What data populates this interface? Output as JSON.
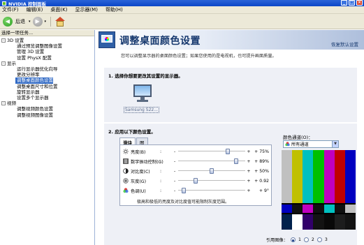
{
  "window": {
    "title": "NVIDIA 控制面板"
  },
  "menu": [
    "文件(F)",
    "编辑(E)",
    "桌面(K)",
    "显示器(M)",
    "帮助(H)"
  ],
  "toolbar": {
    "back_label": "后退"
  },
  "left": {
    "header": "选择一项任务...",
    "tree": [
      {
        "category": "3D 设置",
        "expanded": "-",
        "items": [
          "通过预览调整图像设置",
          "管理 3D 设置",
          "设置 PhysX 配置"
        ]
      },
      {
        "category": "显示",
        "expanded": "-",
        "items": [
          "运行显示器优化向导",
          "更改分辨率",
          "调整桌面颜色设置",
          "调整桌面尺寸和位置",
          "旋转显示器",
          "设置多个显示器"
        ]
      },
      {
        "category": "视频",
        "expanded": "-",
        "items": [
          "调整视频颜色设置",
          "调整视频图像设置"
        ]
      }
    ],
    "selected": "调整桌面颜色设置"
  },
  "main": {
    "title": "调整桌面颜色设置",
    "restore": "恢复默认设置",
    "description": "您可以调整显示器的桌面颜色设置；如果您使用的是电视机，也可提升画面质量。",
    "step1": "1. 选择你想要更改其设置的显示器。",
    "monitor_label": "Samsung S22...",
    "step2": "2. 应用以下颜色设置。",
    "tabs": [
      "滑块",
      "图"
    ],
    "sliders": [
      {
        "name": "亮度(B)",
        "value": "+ 75%",
        "level": 0.75,
        "icon": "brightness-icon"
      },
      {
        "name": "数字振动控制(G)",
        "value": "+ 89%",
        "level": 0.89,
        "icon": "vibrance-icon"
      },
      {
        "name": "对比度(C)",
        "value": "+ 50%",
        "level": 0.5,
        "icon": "contrast-icon"
      },
      {
        "name": "灰度(G)",
        "value": "+ 0.92",
        "level": 0.24,
        "icon": "gamma-icon"
      },
      {
        "name": "色调(U)",
        "value": "+ 9°",
        "level": 0.05,
        "icon": "hue-icon"
      }
    ],
    "note": "极高和极低的亮度及对比度值可能限制灰度范围。",
    "channel_label": "颜色通道(O)：",
    "channel_value": "所有通道",
    "reference_label": "引用图像：",
    "reference_options": [
      "1",
      "2",
      "3"
    ]
  },
  "colors": {
    "bars_top": [
      "#c0c0c0",
      "#c0c000",
      "#00c0c0",
      "#00c000",
      "#c000c0",
      "#c00000",
      "#0000c0"
    ],
    "bars_mid": [
      "#0000c0",
      "#101010",
      "#c000c0",
      "#101010",
      "#00c0c0",
      "#101010",
      "#c0c0c0"
    ],
    "bars_bot": [
      "#00214c",
      "#ffffff",
      "#32006a",
      "#131313",
      "#090909",
      "#1d1d1d",
      "#131313"
    ]
  }
}
